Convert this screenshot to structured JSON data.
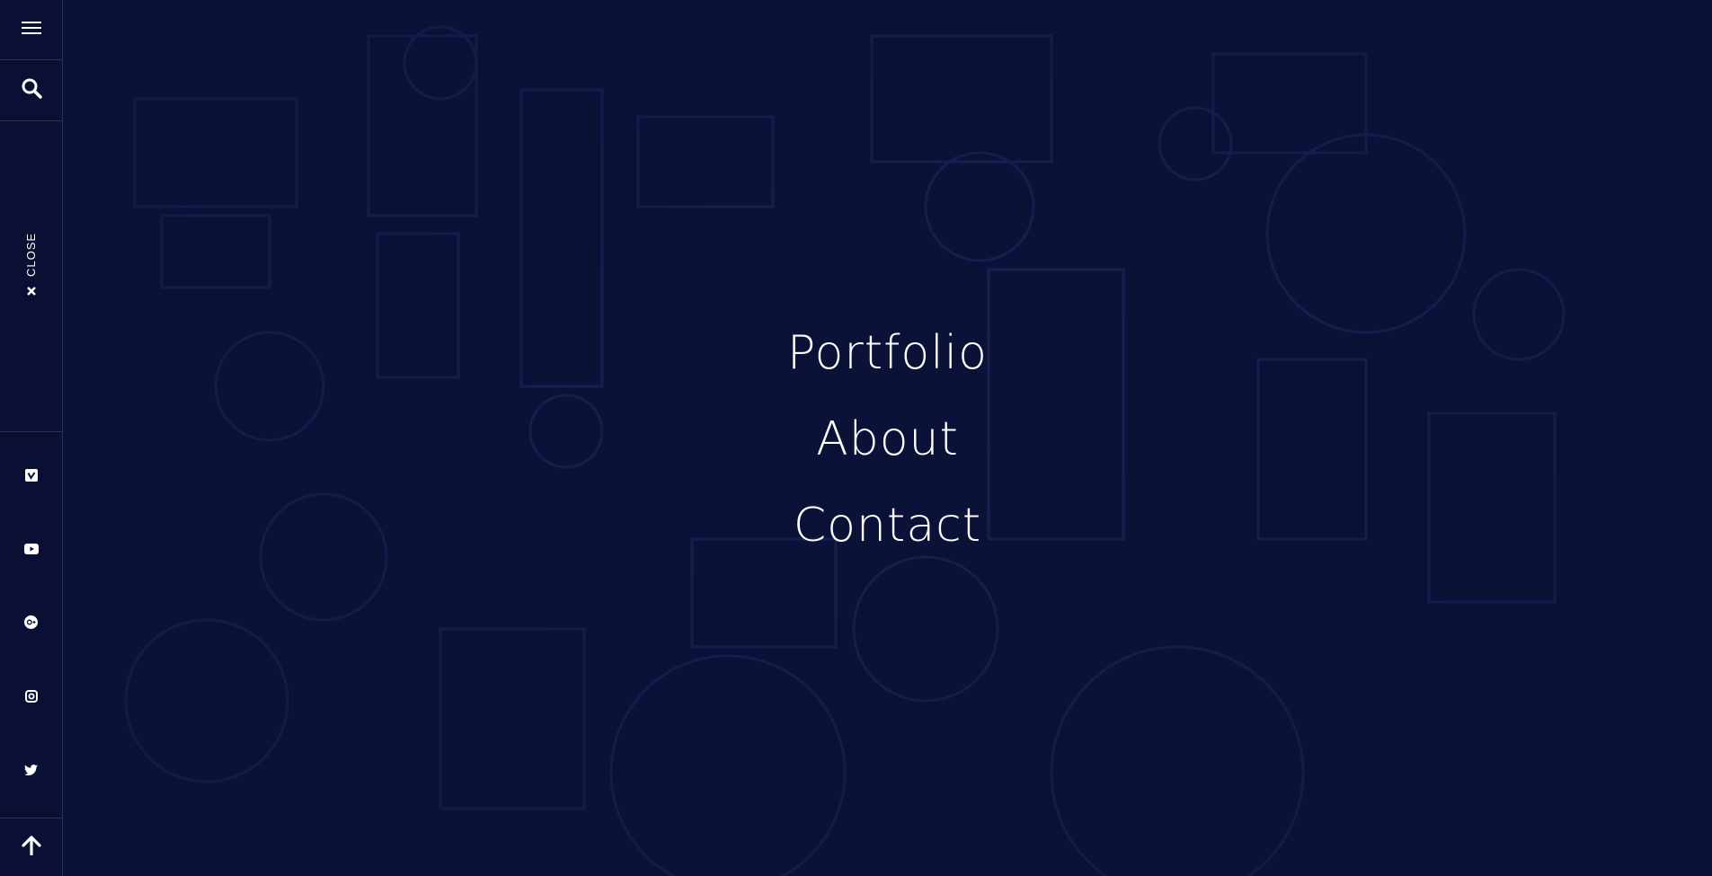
{
  "sidebar": {
    "menu_icon": "hamburger-menu-icon",
    "search_icon": "search-icon",
    "close_label": "CLOSE",
    "close_icon": "close-icon",
    "socials": [
      {
        "name": "vimeo",
        "icon": "vimeo-icon"
      },
      {
        "name": "youtube",
        "icon": "youtube-icon"
      },
      {
        "name": "google-plus",
        "icon": "google-plus-icon"
      },
      {
        "name": "instagram",
        "icon": "instagram-icon"
      },
      {
        "name": "twitter",
        "icon": "twitter-icon"
      }
    ],
    "scroll_top_icon": "arrow-up-icon"
  },
  "nav": {
    "items": [
      {
        "label": "Portfolio"
      },
      {
        "label": "About"
      },
      {
        "label": "Contact"
      }
    ]
  },
  "colors": {
    "background": "#0b1238",
    "text": "#ffffff"
  }
}
